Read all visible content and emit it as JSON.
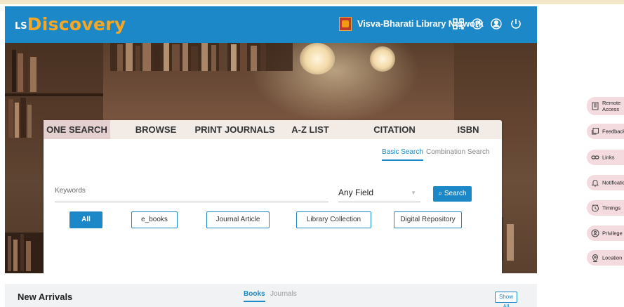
{
  "header": {
    "logo_prefix": "LS",
    "logo_name": "Discovery",
    "institution": "Visva-Bharati Library Network",
    "icons": [
      "qr-code-icon",
      "help-icon",
      "user-icon",
      "power-icon"
    ]
  },
  "search": {
    "tabs": [
      "ONE SEARCH",
      "BROWSE",
      "PRINT JOURNALS",
      "A-Z LIST",
      "CITATION",
      "ISBN"
    ],
    "active_tab": "ONE SEARCH",
    "modes": [
      "Basic Search",
      "Combination Search"
    ],
    "active_mode": "Basic Search",
    "keywords_label": "Keywords",
    "field_value": "Any Field",
    "search_button": "Search",
    "filters": [
      "All",
      "e_books",
      "Journal Article",
      "Library Collection",
      "Digital Repository"
    ],
    "active_filter": "All"
  },
  "arrivals": {
    "title": "New Arrivals",
    "tabs": [
      "Books",
      "Journals"
    ],
    "active_tab": "Books",
    "show_all": "Show All"
  },
  "side_links": [
    {
      "label": "Remote",
      "label2": "Access",
      "icon": "remote-access-icon"
    },
    {
      "label": "Feedback",
      "icon": "feedback-icon"
    },
    {
      "label": "Links",
      "icon": "link-icon"
    },
    {
      "label": "Notificatio",
      "icon": "bell-icon"
    },
    {
      "label": "Timings",
      "icon": "clock-icon"
    },
    {
      "label": "Privilege",
      "icon": "privilege-icon"
    },
    {
      "label": "Location",
      "icon": "location-icon"
    }
  ],
  "colors": {
    "primary": "#1c88c8",
    "logo_accent": "#f5a623",
    "tab_active": "#e5d0d0",
    "side_pill": "#f3dbe0"
  }
}
